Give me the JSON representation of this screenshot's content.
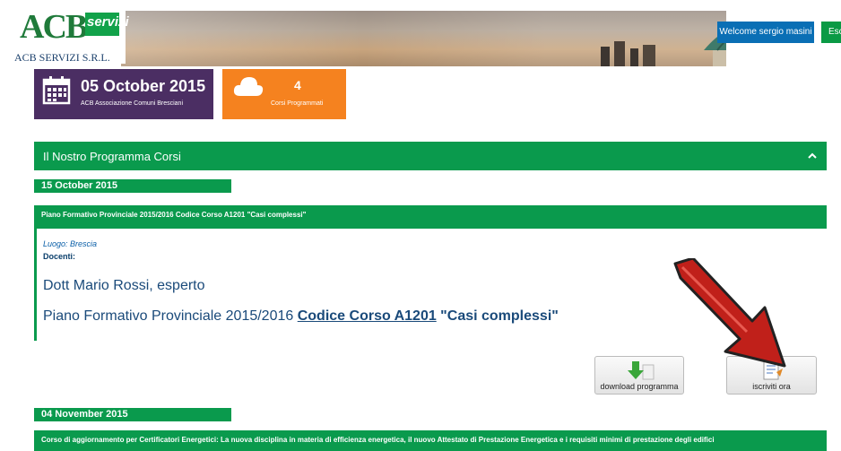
{
  "header": {
    "logo_letters": "ACB",
    "logo_badge": "servizi",
    "company": "ACB SERVIZI S.R.L.",
    "welcome_label": "Welcome sergio masini",
    "logout_label": "Esc"
  },
  "tiles": {
    "date": {
      "main": "05 October 2015",
      "sub": "ACB Associazione Comuni Bresciani",
      "icon": "calendar-icon",
      "color": "#4b2e63"
    },
    "courses": {
      "count": "4",
      "sub": "Corsi Programmati",
      "icon": "cloud-icon",
      "color": "#f5821f"
    }
  },
  "panel": {
    "title": "Il Nostro Programma Corsi",
    "accent": "#0a9a4d"
  },
  "courses": [
    {
      "date": "15 October 2015",
      "title_bar": "Piano Formativo Provinciale 2015/2016 Codice Corso A1201 \"Casi complessi\"",
      "luogo": "Luogo: Brescia",
      "docenti_label": "Docenti:",
      "teacher": "Dott Mario Rossi, esperto",
      "title_plain": "Piano Formativo Provinciale 2015/2016 ",
      "title_code": "Codice Corso A1201",
      "title_quoted": " \"Casi complessi\"",
      "download_label": "download programma",
      "iscriviti_label": "iscriviti ora"
    },
    {
      "date": "04 November 2015",
      "title_bar": "Corso di aggiornamento per Certificatori Energetici: La nuova disciplina in materia di efficienza energetica, il nuovo Attestato di Prestazione Energetica e i requisiti minimi di prestazione degli edifici"
    }
  ]
}
